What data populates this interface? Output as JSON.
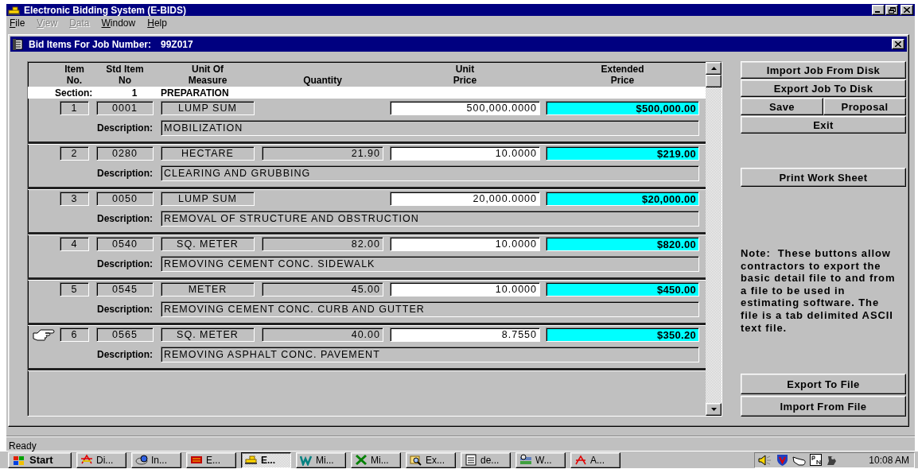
{
  "window": {
    "title": "Electronic Bidding System (E-BIDS)"
  },
  "menu": [
    {
      "label": "File",
      "disabled": false
    },
    {
      "label": "View",
      "disabled": true
    },
    {
      "label": "Data",
      "disabled": true
    },
    {
      "label": "Window",
      "disabled": false
    },
    {
      "label": "Help",
      "disabled": false
    }
  ],
  "child_window": {
    "title": "Bid Items For Job Number:",
    "job_number": "99Z017"
  },
  "columns": [
    {
      "lines": [
        "Item",
        "No."
      ]
    },
    {
      "lines": [
        "Std Item",
        "No"
      ]
    },
    {
      "lines": [
        "Unit Of",
        "Measure"
      ]
    },
    {
      "lines": [
        "Quantity"
      ]
    },
    {
      "lines": [
        "Unit",
        "Price"
      ]
    },
    {
      "lines": [
        "Extended",
        "Price"
      ]
    }
  ],
  "section": {
    "label": "Section:",
    "number": "1",
    "name": "PREPARATION"
  },
  "rows": [
    {
      "item": "1",
      "std_item": "0001",
      "unit": "LUMP SUM",
      "unit_price": "500,000.0000",
      "extended_price": "$500,000.00",
      "description_label": "Description:",
      "description": "MOBILIZATION",
      "current": false
    },
    {
      "item": "2",
      "std_item": "0280",
      "unit": "HECTARE",
      "quantity": "21.90",
      "unit_price": "10.0000",
      "extended_price": "$219.00",
      "description_label": "Description:",
      "description": "CLEARING AND GRUBBING",
      "current": false
    },
    {
      "item": "3",
      "std_item": "0050",
      "unit": "LUMP SUM",
      "unit_price": "20,000.0000",
      "extended_price": "$20,000.00",
      "description_label": "Description:",
      "description": "REMOVAL OF STRUCTURE AND OBSTRUCTION",
      "current": false
    },
    {
      "item": "4",
      "std_item": "0540",
      "unit": "SQ. METER",
      "quantity": "82.00",
      "unit_price": "10.0000",
      "extended_price": "$820.00",
      "description_label": "Description:",
      "description": "REMOVING CEMENT CONC. SIDEWALK",
      "current": false
    },
    {
      "item": "5",
      "std_item": "0545",
      "unit": "METER",
      "quantity": "45.00",
      "unit_price": "10.0000",
      "extended_price": "$450.00",
      "description_label": "Description:",
      "description": "REMOVING CEMENT CONC. CURB AND GUTTER",
      "current": false
    },
    {
      "item": "6",
      "std_item": "0565",
      "unit": "SQ. METER",
      "quantity": "40.00",
      "unit_price": "8.7550",
      "extended_price": "$350.20",
      "description_label": "Description:",
      "description": "REMOVING ASPHALT CONC. PAVEMENT",
      "current": true
    }
  ],
  "side_panel": {
    "buttons": [
      {
        "label": "Import Job From Disk",
        "kind": "wide"
      },
      {
        "label": "Export Job To Disk",
        "kind": "wide"
      },
      {
        "label": "Save",
        "kind": "half"
      },
      {
        "label": "Proposal",
        "kind": "half"
      },
      {
        "label": "Exit",
        "kind": "wide"
      }
    ],
    "print_button": "Print Work Sheet",
    "note": "Note:  These buttons allow contractors to export the basic detail file to and from a file to be used in estimating software. The file is a tab delimited ASCII text file.",
    "file_buttons": [
      "Export To File",
      "Import From File"
    ]
  },
  "status_bar": {
    "text": "Ready"
  },
  "taskbar": {
    "start": "Start",
    "tasks": [
      {
        "label": "Di...",
        "selected": false
      },
      {
        "label": "In...",
        "selected": false
      },
      {
        "label": "E...",
        "selected": false
      },
      {
        "label": "E...",
        "selected": true
      },
      {
        "label": "Mi...",
        "selected": false
      },
      {
        "label": "Mi...",
        "selected": false
      },
      {
        "label": "Ex...",
        "selected": false
      },
      {
        "label": "de...",
        "selected": false
      },
      {
        "label": "W...",
        "selected": false
      },
      {
        "label": "A...",
        "selected": false
      }
    ],
    "clock": "10:08 AM"
  }
}
